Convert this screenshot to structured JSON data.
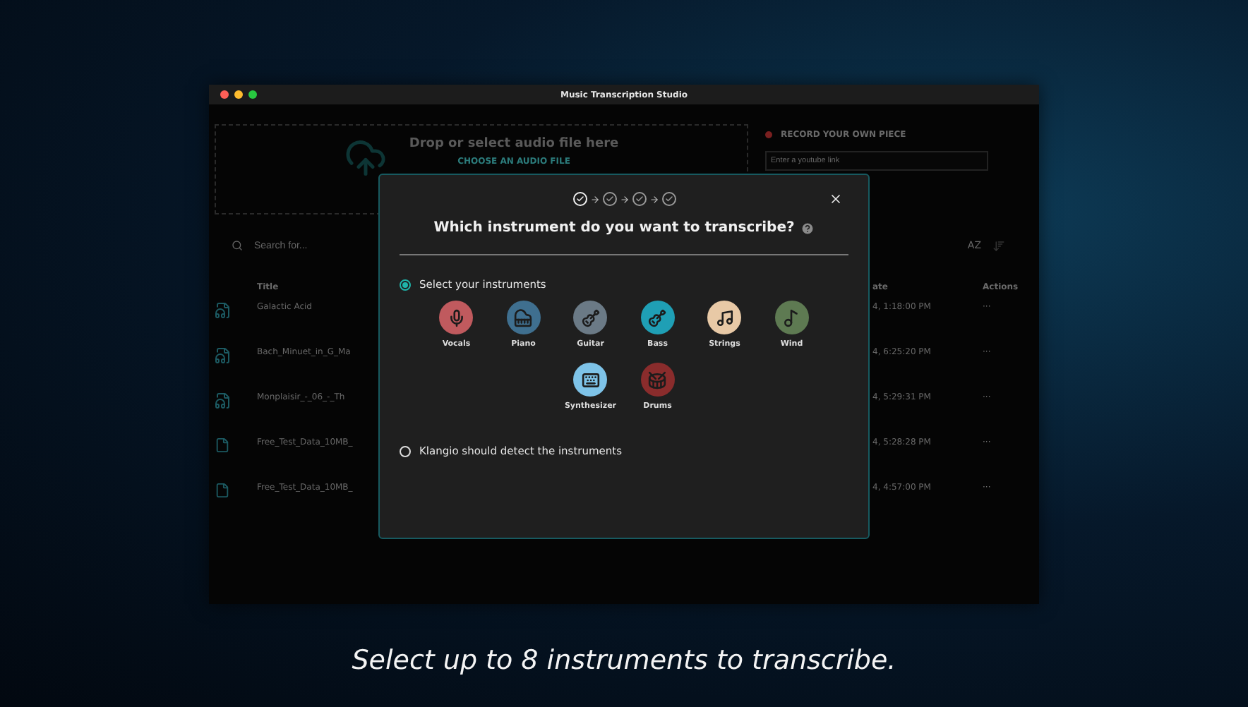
{
  "caption": "Select up to 8 instruments to transcribe.",
  "window": {
    "title": "Music Transcription Studio"
  },
  "upload": {
    "heading": "Drop or select audio file here",
    "button": "CHOOSE AN AUDIO FILE"
  },
  "record": {
    "heading": "RECORD YOUR OWN PIECE",
    "link_placeholder": "Enter a youtube link"
  },
  "search": {
    "placeholder": "Search for...",
    "sort_label": "AZ"
  },
  "table": {
    "columns": [
      "Title",
      "ate",
      "Actions"
    ],
    "rows": [
      {
        "kind": "audio",
        "title": "Galactic Acid",
        "date": "4, 1:18:00 PM",
        "action": "···"
      },
      {
        "kind": "audio",
        "title": "Bach_Minuet_in_G_Ma",
        "date": "4, 6:25:20 PM",
        "action": "···"
      },
      {
        "kind": "audio",
        "title": "Monplaisir_-_06_-_Th",
        "date": "4, 5:29:31 PM",
        "action": "···"
      },
      {
        "kind": "file",
        "title": "Free_Test_Data_10MB_",
        "date": "4, 5:28:28 PM",
        "action": "···"
      },
      {
        "kind": "file",
        "title": "Free_Test_Data_10MB_",
        "date": "4, 4:57:00 PM",
        "action": "···"
      }
    ]
  },
  "modal": {
    "steps": [
      {
        "color": "#f2f2f2"
      },
      {
        "color": "#9a9a9a"
      },
      {
        "color": "#9a9a9a"
      },
      {
        "color": "#9a9a9a"
      }
    ],
    "title": "Which instrument do you want to transcribe?",
    "options": [
      {
        "label": "Select your instruments",
        "selected": true
      },
      {
        "label": "Klangio should detect the instruments",
        "selected": false
      }
    ],
    "instruments": [
      {
        "kind": "vocals",
        "label": "Vocals",
        "color": "#c05a5e"
      },
      {
        "kind": "piano",
        "label": "Piano",
        "color": "#3f6f8f"
      },
      {
        "kind": "guitar",
        "label": "Guitar",
        "color": "#6b7a86"
      },
      {
        "kind": "bass",
        "label": "Bass",
        "color": "#1f9fb5"
      },
      {
        "kind": "strings",
        "label": "Strings",
        "color": "#e8c9a6"
      },
      {
        "kind": "wind",
        "label": "Wind",
        "color": "#5e7a52"
      },
      {
        "kind": "synth",
        "label": "Synthesizer",
        "color": "#7ec3e8"
      },
      {
        "kind": "drums",
        "label": "Drums",
        "color": "#8a2c2c"
      }
    ]
  }
}
